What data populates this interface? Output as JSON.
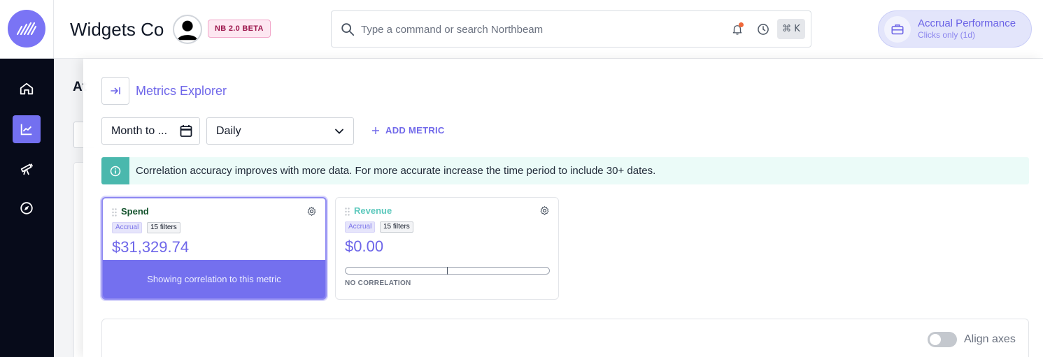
{
  "app": {
    "company": "Widgets Co",
    "beta_badge": "NB 2.0 BETA"
  },
  "search": {
    "placeholder": "Type a command or search Northbeam",
    "shortcut": "⌘ K"
  },
  "accounting": {
    "title": "Accrual Performance",
    "subtitle": "Clicks only (1d)"
  },
  "nav": {
    "items": [
      {
        "name": "home",
        "icon": "home-icon"
      },
      {
        "name": "analytics",
        "icon": "line-chart-icon",
        "active": true
      },
      {
        "name": "telescope",
        "icon": "telescope-icon"
      },
      {
        "name": "explore",
        "icon": "compass-icon"
      }
    ]
  },
  "background": {
    "title_fragment": "At"
  },
  "panel": {
    "title": "Metrics Explorer",
    "date_range": "Month to ...",
    "granularity": "Daily",
    "add_metric": "ADD METRIC",
    "info": "Correlation accuracy improves with more data. For more accurate increase the time period to include 30+ dates."
  },
  "metrics": [
    {
      "name": "Spend",
      "tag": "Accrual",
      "filters": "15 filters",
      "value": "$31,329.74",
      "footer": "Showing correlation to this metric",
      "name_color": "#14532d"
    },
    {
      "name": "Revenue",
      "tag": "Accrual",
      "filters": "15 filters",
      "value": "$0.00",
      "correlation_label": "NO CORRELATION",
      "name_color": "#5ec9bd"
    }
  ],
  "chart": {
    "align_axes_label": "Align axes",
    "align_axes_on": false
  },
  "colors": {
    "accent": "#7470ef",
    "info_teal": "#4ab8ad",
    "rail_bg": "#070b1a"
  }
}
